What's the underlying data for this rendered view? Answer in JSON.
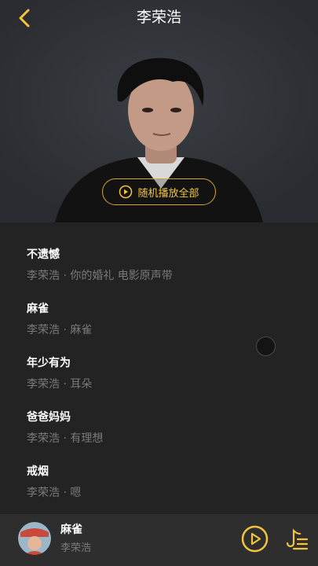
{
  "header": {
    "title": "李荣浩"
  },
  "hero": {
    "play_all_label": "随机播放全部"
  },
  "songs": [
    {
      "title": "不遗憾",
      "subtitle": "李荣浩 · 你的婚礼 电影原声带"
    },
    {
      "title": "麻雀",
      "subtitle": "李荣浩 · 麻雀"
    },
    {
      "title": "年少有为",
      "subtitle": "李荣浩 · 耳朵"
    },
    {
      "title": "爸爸妈妈",
      "subtitle": "李荣浩 · 有理想"
    },
    {
      "title": "戒烟",
      "subtitle": "李荣浩 · 嗯"
    }
  ],
  "now_playing": {
    "title": "麻雀",
    "artist": "李荣浩"
  },
  "colors": {
    "accent": "#f2c53d",
    "background": "#222222",
    "player_bar": "#2e2e2e"
  },
  "icons": {
    "back": "chevron-left-icon",
    "play_all": "play-circle-icon",
    "player_play": "play-circle-icon",
    "playlist": "playlist-icon"
  }
}
